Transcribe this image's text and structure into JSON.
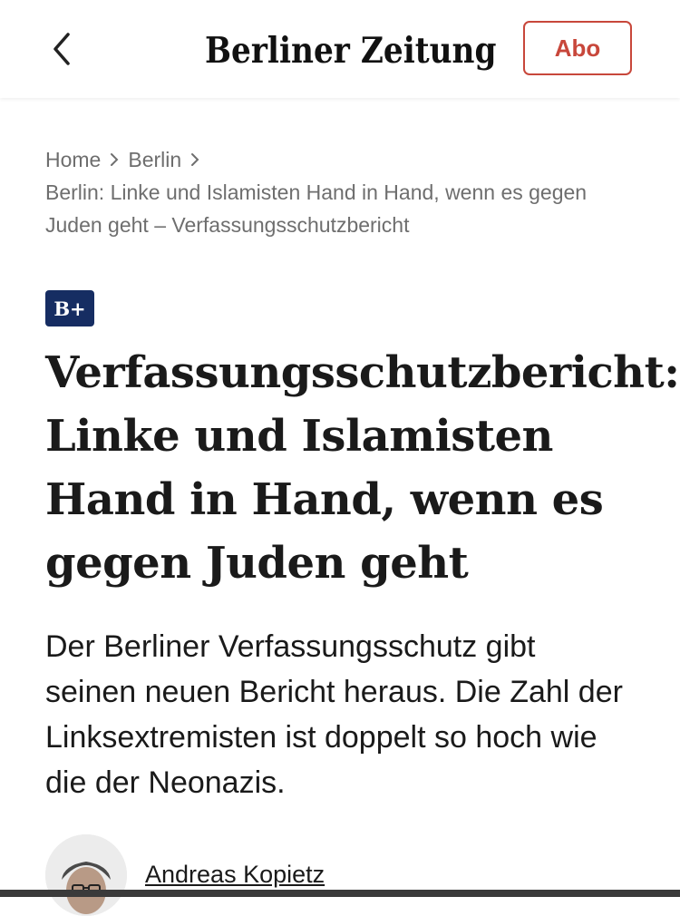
{
  "header": {
    "logo_text": "Berliner Zeitung",
    "abo_label": "Abo",
    "back_icon": "chevron-left-icon"
  },
  "breadcrumb": {
    "home": "Home",
    "section": "Berlin",
    "current": "Berlin: Linke und Islamisten Hand in Hand, wenn es gegen Juden geht – Verfassungsschutzbericht"
  },
  "article": {
    "badge": "B+",
    "headline": "Verfassungsschutzbericht: Linke und Islamisten Hand in Hand, wenn es gegen Juden geht",
    "lead": "Der Berliner Verfassungsschutz gibt seinen neuen Bericht heraus. Die Zahl der Linksextremisten ist doppelt so hoch wie die der Neonazis.",
    "author": "Andreas Kopietz"
  },
  "colors": {
    "accent": "#c8473b",
    "badge_bg": "#162d62",
    "breadcrumb_text": "#6e6e6e"
  }
}
